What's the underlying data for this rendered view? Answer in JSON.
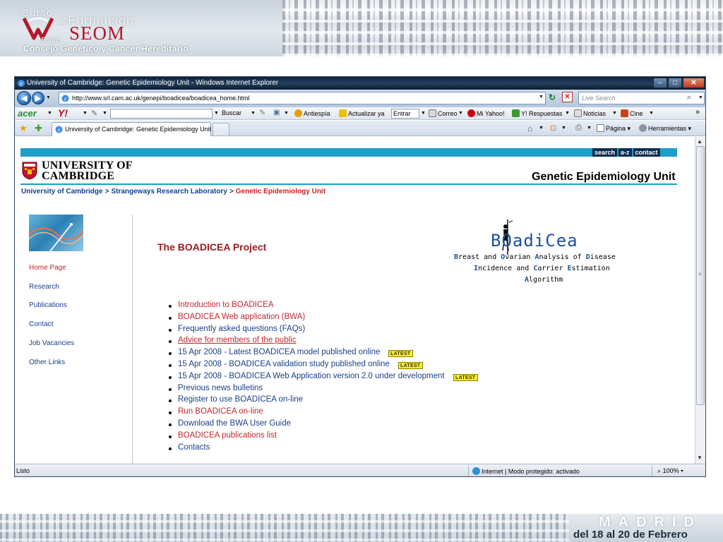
{
  "slide": {
    "header": {
      "curso": "Curso",
      "de": "de",
      "formacion": "Formación",
      "seom": "SEOM",
      "sobre": "Sobre",
      "consejo": "Consejo Genético y Cáncer Hereditario"
    },
    "footer": {
      "city": "MADRID",
      "dates": "del 18 al 20 de Febrero"
    }
  },
  "browser": {
    "title": "University of Cambridge: Genetic Epidemiology Unit - Windows Internet Explorer",
    "window_buttons": {
      "minimize": "–",
      "maximize": "□",
      "close": "✕"
    },
    "url": "http://www.srl.cam.ac.uk/genepi/boadicea/boadicea_home.html",
    "search_placeholder": "Live Search",
    "toolbar": {
      "acer": "acer",
      "yahoo": "Y!",
      "buscar": "Buscar",
      "antiespia": "Antiespía",
      "actualizar": "Actualizar ya",
      "entrar": "Entrar",
      "correo": "Correo",
      "mi_yahoo": "Mi Yahoo!",
      "respuestas": "Y! Respuestas",
      "noticias": "Noticias",
      "cine": "Cine",
      "more": "»"
    },
    "tab": {
      "title": "University of Cambridge: Genetic Epidemiology Unit ...",
      "pagina": "Página",
      "herramientas": "Herramientas"
    },
    "status": {
      "text": "Listo",
      "zone": "Internet | Modo protegido: activado",
      "zoom": "100%"
    }
  },
  "page": {
    "tools": [
      "search",
      "a-z",
      "contact"
    ],
    "university_line1": "UNIVERSITY OF",
    "university_line2": "CAMBRIDGE",
    "unit_title": "Genetic Epidemiology Unit",
    "breadcrumb": {
      "item1": "University of Cambridge",
      "item2": "Strangeways Research Laboratory",
      "current": "Genetic Epidemiology Unit",
      "sep": ">"
    },
    "sidebar": [
      {
        "label": "Home Page"
      },
      {
        "label": "Research"
      },
      {
        "label": "Publications"
      },
      {
        "label": "Contact"
      },
      {
        "label": "Job Vacancies"
      },
      {
        "label": "Other Links"
      }
    ],
    "project_title": "The BOADICEA Project",
    "logo": {
      "word": "BOadiCea",
      "line1": [
        {
          "c": "B",
          "r": "reast and "
        },
        {
          "c": "O",
          "r": "varian "
        },
        {
          "c": "A",
          "r": "nalysis of "
        },
        {
          "c": "D",
          "r": "isease"
        }
      ],
      "line2": [
        {
          "c": "I",
          "r": "ncidence and "
        },
        {
          "c": "C",
          "r": "arrier "
        },
        {
          "c": "E",
          "r": "stimation"
        }
      ],
      "line3": [
        {
          "c": "A",
          "r": "lgorithm"
        }
      ]
    },
    "latest_badge": "LATEST",
    "links": [
      {
        "text": "Introduction to BOADICEA"
      },
      {
        "text": "BOADICEA Web application (BWA)"
      },
      {
        "text": "Frequently asked questions (FAQs)"
      },
      {
        "text": "Advice for members of the public"
      },
      {
        "text": "15 Apr 2008 - Latest BOADICEA model published online"
      },
      {
        "text": "15 Apr 2008 - BOADICEA validation study published online"
      },
      {
        "text": "15 Apr 2008 - BOADICEA Web Application version 2.0 under development"
      },
      {
        "text": "Previous news bulletins"
      },
      {
        "text": "Register to use BOADICEA on-line"
      },
      {
        "text": "Run BOADICEA on-line"
      },
      {
        "text": "Download the BWA User Guide"
      },
      {
        "text": "BOADICEA publications list"
      },
      {
        "text": "Contacts"
      }
    ]
  },
  "colors": {
    "cambridge_blue": "#1e9ec9",
    "link_blue": "#1a3f8a",
    "link_red": "#c0282d",
    "title_red": "#9a1b1e",
    "seom_red": "#b3192b"
  }
}
